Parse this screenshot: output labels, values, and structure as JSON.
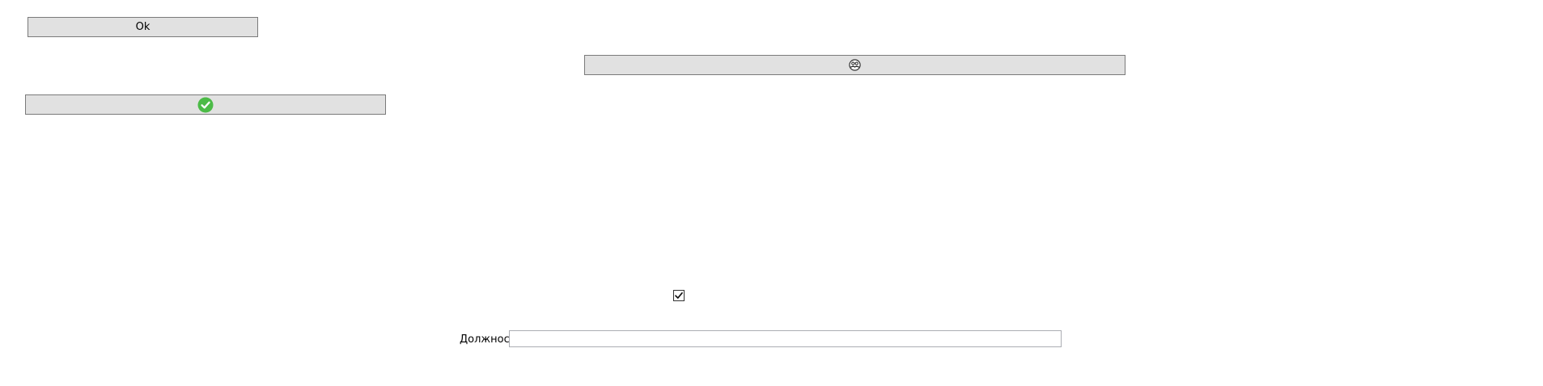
{
  "buttons": {
    "ok_label": "Ok",
    "people_icon": "people-group-icon",
    "check_icon": "green-check-circle-icon"
  },
  "checkbox": {
    "checked": true
  },
  "position_field": {
    "label": "Должность",
    "value": ""
  },
  "colors": {
    "button_bg": "#e1e1e1",
    "button_border": "#7a7a7a",
    "check_green": "#4cbb47"
  }
}
